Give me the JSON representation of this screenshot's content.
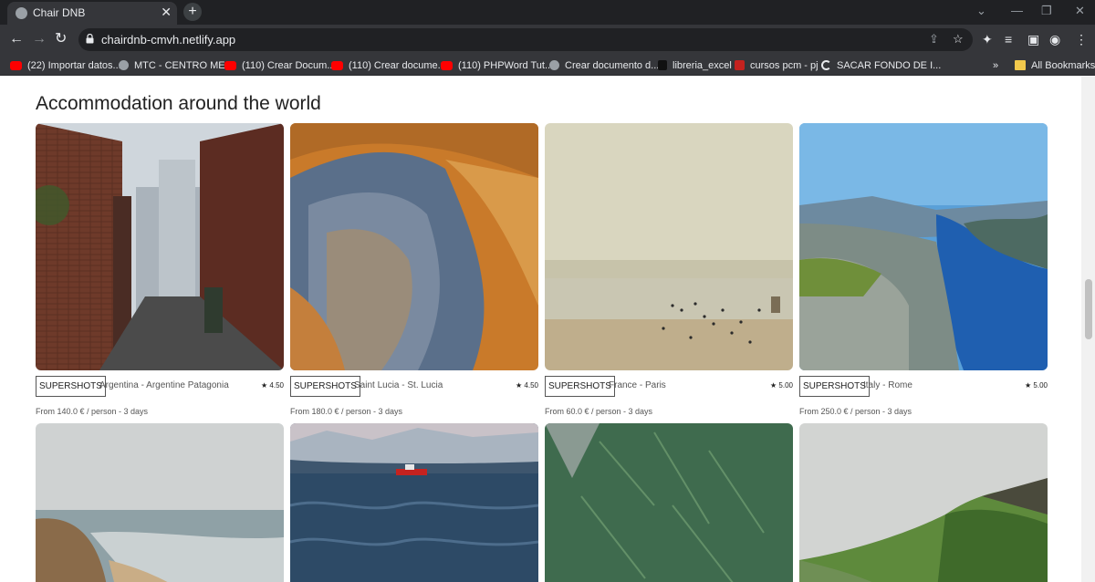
{
  "browser": {
    "tab_title": "Chair DNB",
    "url": "chairdnb-cmvh.netlify.app",
    "new_tab": "+",
    "close": "✕",
    "bookmarks": [
      {
        "label": "(22) Importar datos...",
        "icon": "youtube-icon"
      },
      {
        "label": "MTC - CENTRO ME...",
        "icon": "globe-icon"
      },
      {
        "label": "(110) Crear Docum...",
        "icon": "youtube-icon"
      },
      {
        "label": "(110) Crear docume...",
        "icon": "youtube-icon"
      },
      {
        "label": "(110) PHPWord Tut...",
        "icon": "youtube-icon"
      },
      {
        "label": "Crear documento d...",
        "icon": "wordpress-icon"
      },
      {
        "label": "libreria_excel",
        "icon": "dark-icon"
      },
      {
        "label": "cursos pcm - pj",
        "icon": "red-icon"
      },
      {
        "label": "SACAR FONDO DE I...",
        "icon": "c-icon"
      }
    ],
    "more_bookmarks": "»",
    "all_bookmarks": "All Bookmarks"
  },
  "page": {
    "section_title": "Accommodation around the world",
    "cards": [
      {
        "badge": "SUPERSHOTS",
        "location": "Argentina - Argentine Patagonia",
        "rating": "★ 4.50",
        "price": "From 140.0 € / person - 3 days"
      },
      {
        "badge": "SUPERSHOTS",
        "location": "Saint Lucia - St. Lucia",
        "rating": "★ 4.50",
        "price": "From 180.0 € / person - 3 days"
      },
      {
        "badge": "SUPERSHOTS",
        "location": "France - Paris",
        "rating": "★ 5.00",
        "price": "From 60.0 € / person - 3 days"
      },
      {
        "badge": "SUPERSHOTS",
        "location": "Italy - Rome",
        "rating": "★ 5.00",
        "price": "From 250.0 € / person - 3 days"
      }
    ]
  }
}
